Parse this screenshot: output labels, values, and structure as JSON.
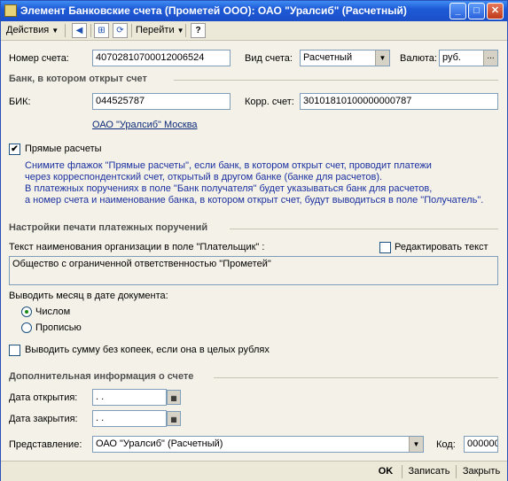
{
  "window": {
    "title": "Элемент Банковские счета (Прометей ООО): ОАО \"Уралсиб\"  (Расчетный)"
  },
  "toolbar": {
    "actions_label": "Действия",
    "goto_label": "Перейти",
    "help_label": "?"
  },
  "account": {
    "number_label": "Номер счета:",
    "number_value": "40702810700012006524",
    "type_label": "Вид счета:",
    "type_value": "Расчетный",
    "currency_label": "Валюта:",
    "currency_value": "руб.",
    "currency_btn": "..."
  },
  "bank": {
    "section_title": "Банк, в котором открыт счет",
    "bik_label": "БИК:",
    "bik_value": "044525787",
    "corr_label": "Корр. счет:",
    "corr_value": "30101810100000000787",
    "bank_link": "ОАО \"Уралсиб\" Москва"
  },
  "direct": {
    "label": "Прямые расчеты",
    "checked": true,
    "hint_lines": [
      "Снимите флажок \"Прямые расчеты\", если банк, в котором открыт счет, проводит платежи",
      "через корреспондентский счет, открытый в другом банке (банке для расчетов).",
      "В платежных поручениях в поле \"Банк получателя\" будет указываться банк для расчетов,",
      "а номер счета и наименование банка, в котором открыт счет, будут выводиться в поле \"Получатель\"."
    ]
  },
  "print": {
    "section_title": "Настройки печати платежных поручений",
    "payer_label": "Текст наименования организации в поле \"Плательщик\" :",
    "edit_text_label": "Редактировать текст",
    "payer_text": "Общество с ограниченной ответственностью \"Прометей\"",
    "month_label": "Выводить месяц в дате документа:",
    "radio_number": "Числом",
    "radio_words": "Прописью",
    "no_kopecks_label": "Выводить сумму без копеек, если она в целых рублях"
  },
  "extra": {
    "section_title": "Дополнительная информация о счете",
    "open_label": "Дата открытия:",
    "open_value": " .  .",
    "close_label": "Дата закрытия:",
    "close_value": " .  .",
    "repr_label": "Представление:",
    "repr_value": "ОАО \"Уралсиб\"  (Расчетный)",
    "code_label": "Код:",
    "code_value": "000000"
  },
  "footer": {
    "ok": "OK",
    "save": "Записать",
    "close": "Закрыть"
  }
}
